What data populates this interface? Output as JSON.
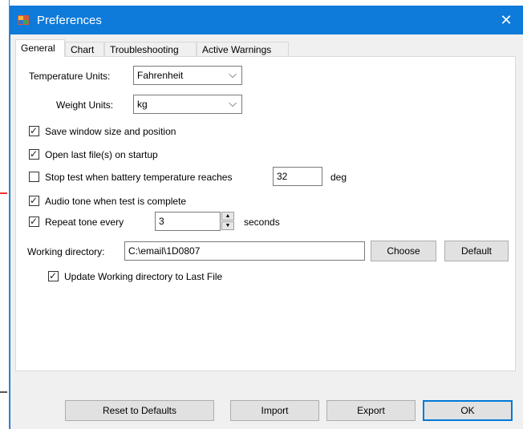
{
  "window": {
    "title": "Preferences",
    "close_glyph": "✕"
  },
  "tabs": [
    {
      "label": "General",
      "active": true
    },
    {
      "label": "Chart",
      "active": false
    },
    {
      "label": "Troubleshooting",
      "active": false
    },
    {
      "label": "Active Warnings",
      "active": false
    }
  ],
  "general": {
    "temperature_units_label": "Temperature Units:",
    "temperature_units_value": "Fahrenheit",
    "weight_units_label": "Weight Units:",
    "weight_units_value": "kg",
    "checkboxes": {
      "save_window": {
        "label": "Save window size and position",
        "checked": true
      },
      "open_last": {
        "label": "Open last file(s) on startup",
        "checked": true
      },
      "stop_test": {
        "label": "Stop test when battery temperature reaches",
        "checked": false
      },
      "audio_tone": {
        "label": "Audio tone when test is complete",
        "checked": true
      },
      "repeat_tone": {
        "label": "Repeat tone every",
        "checked": true
      },
      "update_dir": {
        "label": "Update Working directory to Last File",
        "checked": true
      }
    },
    "stop_temp_value": "32",
    "stop_temp_unit": "deg",
    "repeat_value": "3",
    "repeat_unit": "seconds",
    "working_dir_label": "Working directory:",
    "working_dir_value": "C:\\email\\1D0807",
    "choose_label": "Choose",
    "default_label": "Default"
  },
  "footer": {
    "reset_label": "Reset to Defaults",
    "import_label": "Import",
    "export_label": "Export",
    "ok_label": "OK"
  },
  "colors": {
    "titlebar": "#0e7ad9",
    "accent": "#0078d7"
  },
  "icons": {
    "app": "app-logo-icon",
    "close": "close-icon",
    "check": "check-icon",
    "chevron": "chevron-down-icon"
  }
}
